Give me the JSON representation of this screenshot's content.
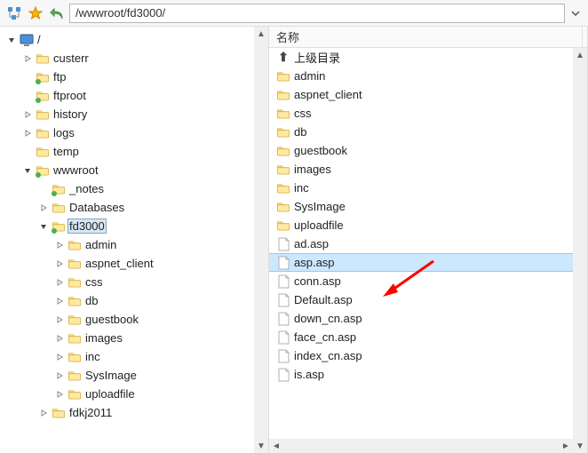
{
  "toolbar": {
    "path": "/wwwroot/fd3000/"
  },
  "tree": {
    "root_label": "/",
    "items": [
      {
        "label": "custerr",
        "expander": ">"
      },
      {
        "label": "ftp",
        "expander": "",
        "green": true
      },
      {
        "label": "ftproot",
        "expander": "",
        "green": true
      },
      {
        "label": "history",
        "expander": ">"
      },
      {
        "label": "logs",
        "expander": ">"
      },
      {
        "label": "temp",
        "expander": ""
      },
      {
        "label": "wwwroot",
        "expander": "v",
        "green": true,
        "children": [
          {
            "label": "_notes",
            "expander": "",
            "green": true
          },
          {
            "label": "Databases",
            "expander": ">"
          },
          {
            "label": "fd3000",
            "expander": "v",
            "green": true,
            "selected": true,
            "children": [
              {
                "label": "admin",
                "expander": ">"
              },
              {
                "label": "aspnet_client",
                "expander": ">"
              },
              {
                "label": "css",
                "expander": ">"
              },
              {
                "label": "db",
                "expander": ">"
              },
              {
                "label": "guestbook",
                "expander": ">"
              },
              {
                "label": "images",
                "expander": ">"
              },
              {
                "label": "inc",
                "expander": ">"
              },
              {
                "label": "SysImage",
                "expander": ">"
              },
              {
                "label": "uploadfile",
                "expander": ">"
              }
            ]
          },
          {
            "label": "fdkj2011",
            "expander": ">"
          }
        ]
      }
    ]
  },
  "list": {
    "header": "名称",
    "up_label": "上级目录",
    "items": [
      {
        "label": "admin",
        "type": "folder"
      },
      {
        "label": "aspnet_client",
        "type": "folder"
      },
      {
        "label": "css",
        "type": "folder"
      },
      {
        "label": "db",
        "type": "folder"
      },
      {
        "label": "guestbook",
        "type": "folder"
      },
      {
        "label": "images",
        "type": "folder"
      },
      {
        "label": "inc",
        "type": "folder"
      },
      {
        "label": "SysImage",
        "type": "folder"
      },
      {
        "label": "uploadfile",
        "type": "folder"
      },
      {
        "label": "ad.asp",
        "type": "file"
      },
      {
        "label": "asp.asp",
        "type": "file",
        "selected": true
      },
      {
        "label": "conn.asp",
        "type": "file"
      },
      {
        "label": "Default.asp",
        "type": "file"
      },
      {
        "label": "down_cn.asp",
        "type": "file"
      },
      {
        "label": "face_cn.asp",
        "type": "file"
      },
      {
        "label": "index_cn.asp",
        "type": "file"
      },
      {
        "label": "is.asp",
        "type": "file"
      }
    ]
  }
}
